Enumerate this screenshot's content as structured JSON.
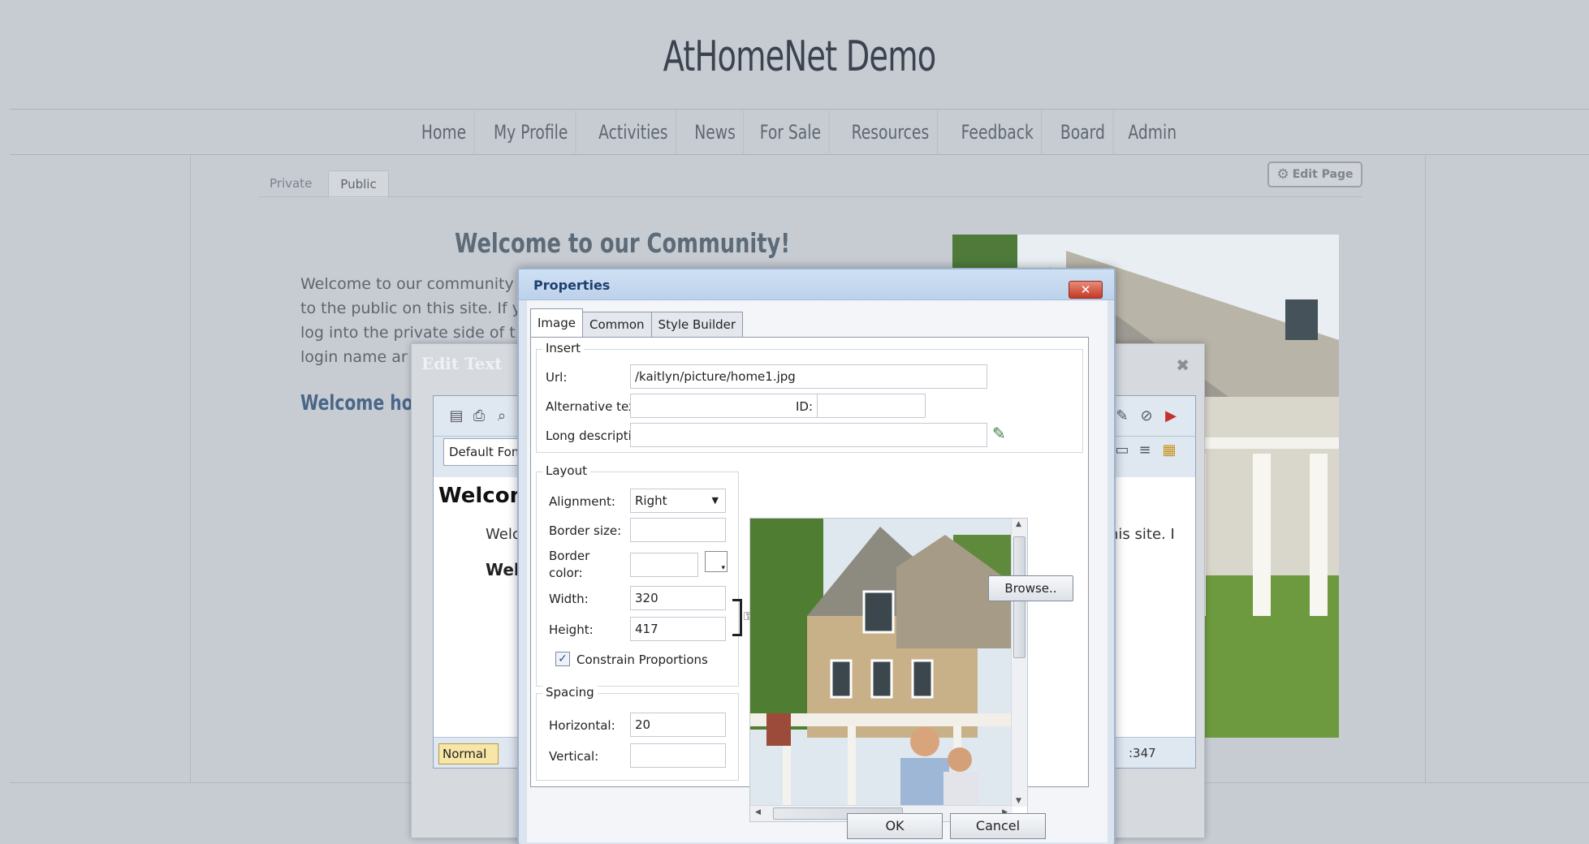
{
  "site": {
    "title": "AtHomeNet Demo",
    "nav": [
      "Home",
      "My Profile",
      "Activities",
      "News",
      "For Sale",
      "Resources",
      "Feedback",
      "Board",
      "Admin"
    ],
    "page_tabs": [
      "Private",
      "Public"
    ],
    "edit_page_label": "Edit Page",
    "welcome_heading": "Welcome to our Community!",
    "welcome_lines": [
      "Welcome to our community",
      "to the public on this site. If y",
      "log into the private side of t",
      "login name ar"
    ],
    "welcome_home": "Welcome home"
  },
  "edit_text": {
    "title": "Edit Text",
    "font_select": "Default Fon",
    "heading": "Welcom",
    "line1": "Welc",
    "line2": "Wel",
    "right_text": "his site. I",
    "mode_button": "Normal",
    "size_readout": ":347"
  },
  "dialog": {
    "title": "Properties",
    "tabs": [
      "Image",
      "Common",
      "Style Builder"
    ],
    "insert": {
      "legend": "Insert",
      "url_label": "Url:",
      "url_value": "/kaitlyn/picture/home1.jpg",
      "browse": "Browse..",
      "alt_label": "Alternative text:",
      "alt_value": "",
      "id_label": "ID:",
      "id_value": "",
      "longdesc_label": "Long description:",
      "longdesc_value": ""
    },
    "layout": {
      "legend": "Layout",
      "alignment_label": "Alignment:",
      "alignment_value": "Right",
      "border_size_label": "Border size:",
      "border_size_value": "",
      "border_color_label_1": "Border",
      "border_color_label_2": "color:",
      "width_label": "Width:",
      "width_value": "320",
      "height_label": "Height:",
      "height_value": "417",
      "constrain_label": "Constrain Proportions",
      "constrain_checked": true
    },
    "spacing": {
      "legend": "Spacing",
      "horizontal_label": "Horizontal:",
      "horizontal_value": "20",
      "vertical_label": "Vertical:",
      "vertical_value": ""
    },
    "buttons": {
      "ok": "OK",
      "cancel": "Cancel"
    }
  }
}
